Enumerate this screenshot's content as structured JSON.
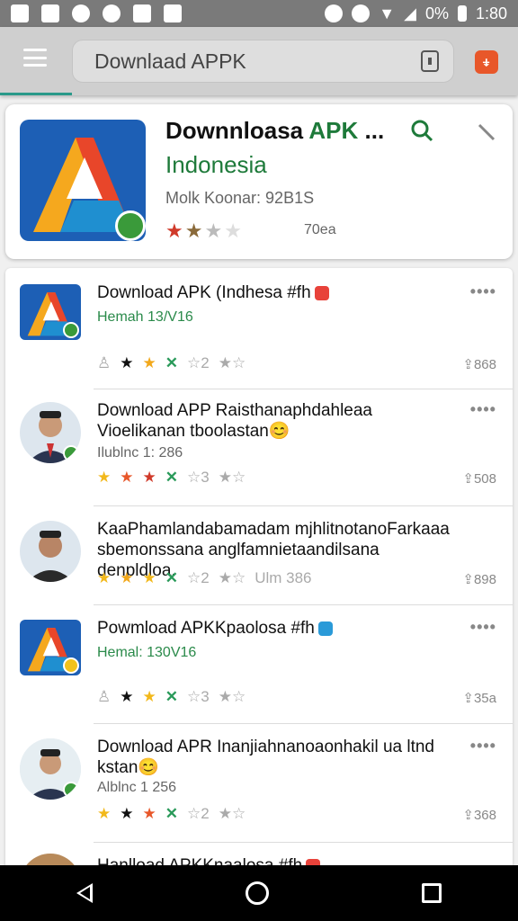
{
  "status_bar": {
    "battery": "0%",
    "time": "1:80"
  },
  "search": {
    "value": "Downlaad APPK"
  },
  "feature": {
    "title": "Downnloasa",
    "title_accent": "APK",
    "title_suffix": " ...",
    "subtitle": "Indonesia",
    "meta": "Molk Koonar: 92B1S",
    "rating_count": "70ea",
    "stars": {
      "filled": 2,
      "total": 4
    }
  },
  "rows": [
    {
      "title": "Download APK (Indhesa #fh",
      "sub": "Hemah 13/V16",
      "sub_style": "green",
      "share": "868",
      "type": "app",
      "tag_color": "#e8423a",
      "badge": "green"
    },
    {
      "title": "Download APP Raisthanaphdahleaa Vioelikanan tboolastan😊",
      "sub": "Ilublnc 1: 286",
      "sub_style": "gray",
      "share": "508",
      "type": "person",
      "badge": "green"
    },
    {
      "title": "KaaPhamlandabamadam mjhlitnotanoFarkaaa sbemonssana anglfamnietaandilsana denpldloa.",
      "sub": "",
      "sub_style": "gray",
      "share": "898",
      "type": "person",
      "inline_meta": "Ulm 386"
    },
    {
      "title": "Powmload APKKpaolosa #fh",
      "sub": "Hemal: 130V16",
      "sub_style": "green",
      "share": "35a",
      "type": "app",
      "tag_color": "#2a9ad8",
      "badge": "yellow"
    },
    {
      "title": "Download APR Inanjiahnanoaonhakil ua ltnd kstan😊",
      "sub": "Alblnc 1 256",
      "sub_style": "gray",
      "share": "368",
      "type": "person",
      "badge": "green"
    },
    {
      "title": "Hanlload APKKnaalosa #fh",
      "sub": "",
      "sub_style": "gray",
      "share": "",
      "type": "person",
      "tag_color": "#e8423a"
    }
  ],
  "more_label": "••••",
  "colors": {
    "accent_green": "#1e7a3a",
    "brand_blue": "#1d5fb5",
    "toolbar": "#cfcfcf"
  }
}
